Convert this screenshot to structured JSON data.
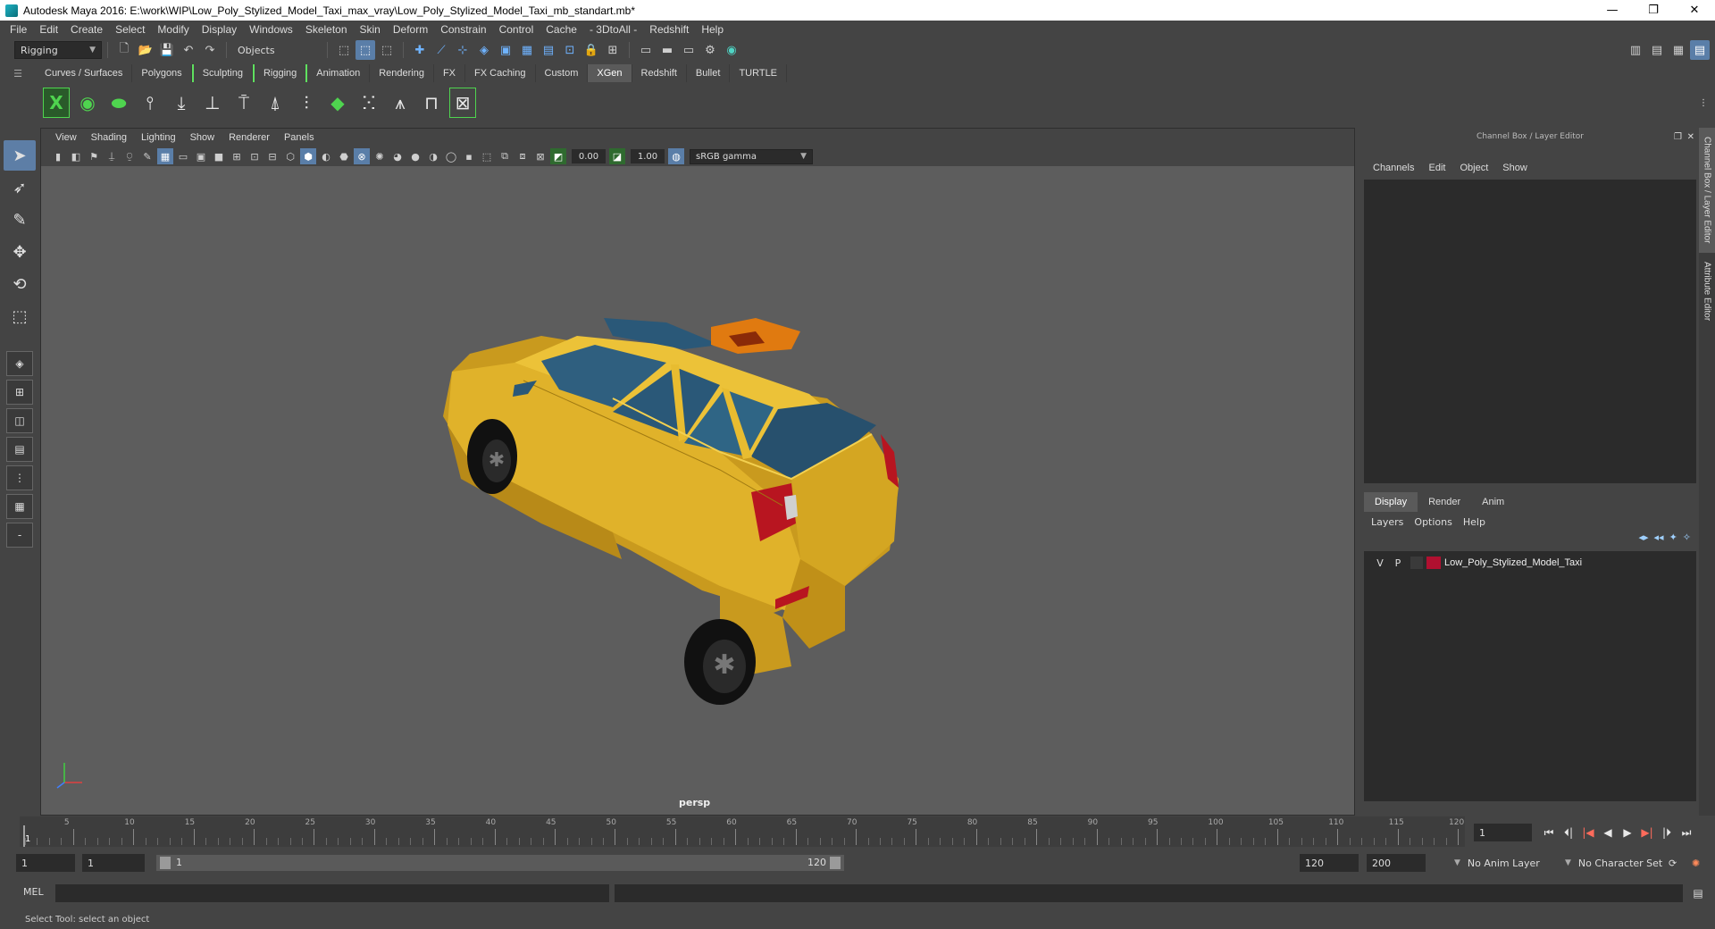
{
  "window": {
    "title": "Autodesk Maya 2016: E:\\work\\WIP\\Low_Poly_Stylized_Model_Taxi_max_vray\\Low_Poly_Stylized_Model_Taxi_mb_standart.mb*",
    "minimize": "—",
    "restore": "❐",
    "close": "✕"
  },
  "menubar": [
    "File",
    "Edit",
    "Create",
    "Select",
    "Modify",
    "Display",
    "Windows",
    "Skeleton",
    "Skin",
    "Deform",
    "Constrain",
    "Control",
    "Cache",
    "- 3DtoAll -",
    "Redshift",
    "Help"
  ],
  "statusline": {
    "menuset": "Rigging",
    "selection_mode": "Objects"
  },
  "shelf": {
    "tabs": [
      "Curves / Surfaces",
      "Polygons",
      "Sculpting",
      "Rigging",
      "Animation",
      "Rendering",
      "FX",
      "FX Caching",
      "Custom",
      "XGen",
      "Redshift",
      "Bullet",
      "TURTLE"
    ],
    "active_tab": "XGen"
  },
  "viewport": {
    "menus": [
      "View",
      "Shading",
      "Lighting",
      "Show",
      "Renderer",
      "Panels"
    ],
    "exposure": "0.00",
    "gamma": "1.00",
    "color_space": "sRGB gamma",
    "camera": "persp"
  },
  "channelbox": {
    "title": "Channel Box / Layer Editor",
    "menus": [
      "Channels",
      "Edit",
      "Object",
      "Show"
    ],
    "layer_tabs": [
      "Display",
      "Render",
      "Anim"
    ],
    "active_layer_tab": "Display",
    "layer_menus": [
      "Layers",
      "Options",
      "Help"
    ],
    "layers": [
      {
        "v": "V",
        "p": "P",
        "name": "Low_Poly_Stylized_Model_Taxi",
        "color": "#b01030"
      }
    ]
  },
  "side_tabs": [
    "Channel Box / Layer Editor",
    "Attribute Editor"
  ],
  "timeslider": {
    "ticks": [
      5,
      10,
      15,
      20,
      25,
      30,
      35,
      40,
      45,
      50,
      55,
      60,
      65,
      70,
      75,
      80,
      85,
      90,
      95,
      100,
      105,
      110,
      115,
      120
    ],
    "range_min": 1,
    "range_max": 120,
    "current_label": "1",
    "current_frame": "1"
  },
  "rangeslider": {
    "start": "1",
    "playback_start": "1",
    "bar_start": "1",
    "bar_end": "120",
    "playback_end": "120",
    "end": "200",
    "anim_layer": "No Anim Layer",
    "character_set": "No Character Set"
  },
  "cmdline": {
    "label": "MEL"
  },
  "helpline": {
    "text": "Select Tool: select an object"
  },
  "colors": {
    "taxi_body": "#e0b22a",
    "taxi_glass": "#2f5f7f",
    "taxi_light": "#b81520",
    "layer_swatch": "#b01030"
  }
}
